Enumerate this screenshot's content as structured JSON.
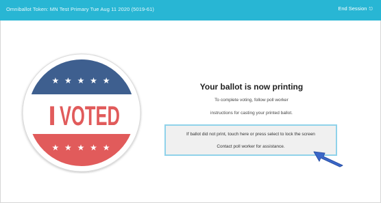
{
  "header": {
    "title": "Omniballot Token: MN Test Primary Tue Aug 11 2020 (5019-61)",
    "end_session_label": "End Session",
    "end_session_icon": "exit-icon",
    "bar_color": "#28b6d4"
  },
  "sticker": {
    "text_i": "I",
    "text_voted": "VOTED",
    "stars_top": "★ ★ ★ ★ ★",
    "stars_bottom": "★ ★ ★ ★ ★",
    "blue": "#3e5f8f",
    "red": "#e15b5b",
    "text_blue": "#47a9d3"
  },
  "message": {
    "headline": "Your ballot is now printing",
    "line1": "To complete voting, follow poll worker",
    "line2": "instructions for casting your printed ballot."
  },
  "reprint": {
    "line1": "If ballot did not print, touch here or press select to lock the screen",
    "line2": "Contact poll worker for assistance."
  },
  "arrow": {
    "icon": "arrow-pointer-icon",
    "color": "#3a67c9"
  }
}
